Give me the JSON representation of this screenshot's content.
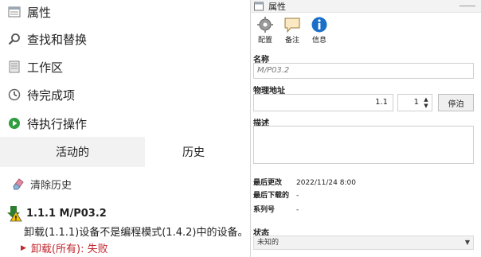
{
  "left_nav": {
    "items": [
      {
        "label": "属性",
        "icon": "properties-icon"
      },
      {
        "label": "查找和替换",
        "icon": "search-icon"
      },
      {
        "label": "工作区",
        "icon": "workspace-icon"
      },
      {
        "label": "待完成项",
        "icon": "clock-icon"
      },
      {
        "label": "待执行操作",
        "icon": "play-icon"
      }
    ]
  },
  "tabs": {
    "active_label": "活动的",
    "history_label": "历史"
  },
  "history": {
    "clear_label": "清除历史",
    "entry_title": "1.1.1 M/P03.2",
    "entry_message": "卸载(1.1.1)设备不是编程模式(1.4.2)中的设备。",
    "entry_result": "卸载(所有): 失败"
  },
  "right_panel": {
    "title": "属性",
    "toolbar": [
      {
        "label": "配置",
        "icon": "gear-icon"
      },
      {
        "label": "备注",
        "icon": "note-icon"
      },
      {
        "label": "信息",
        "icon": "info-icon"
      }
    ],
    "name_label": "名称",
    "name_value": "M/P03.2",
    "address_label": "物理地址",
    "address_main": "1.1",
    "address_sub": "1",
    "stop_button": "停泊",
    "description_label": "描述",
    "last_changed_label": "最后更改",
    "last_changed_value": "2022/11/24 8:00",
    "last_downloaded_label": "最后下载的",
    "last_downloaded_value": "-",
    "serial_label": "系列号",
    "serial_value": "-",
    "state_label": "状态",
    "state_value": "未知的"
  },
  "colors": {
    "error": "#c0272d",
    "info_blue": "#1a6fc9",
    "play_green": "#2e9e3f"
  }
}
